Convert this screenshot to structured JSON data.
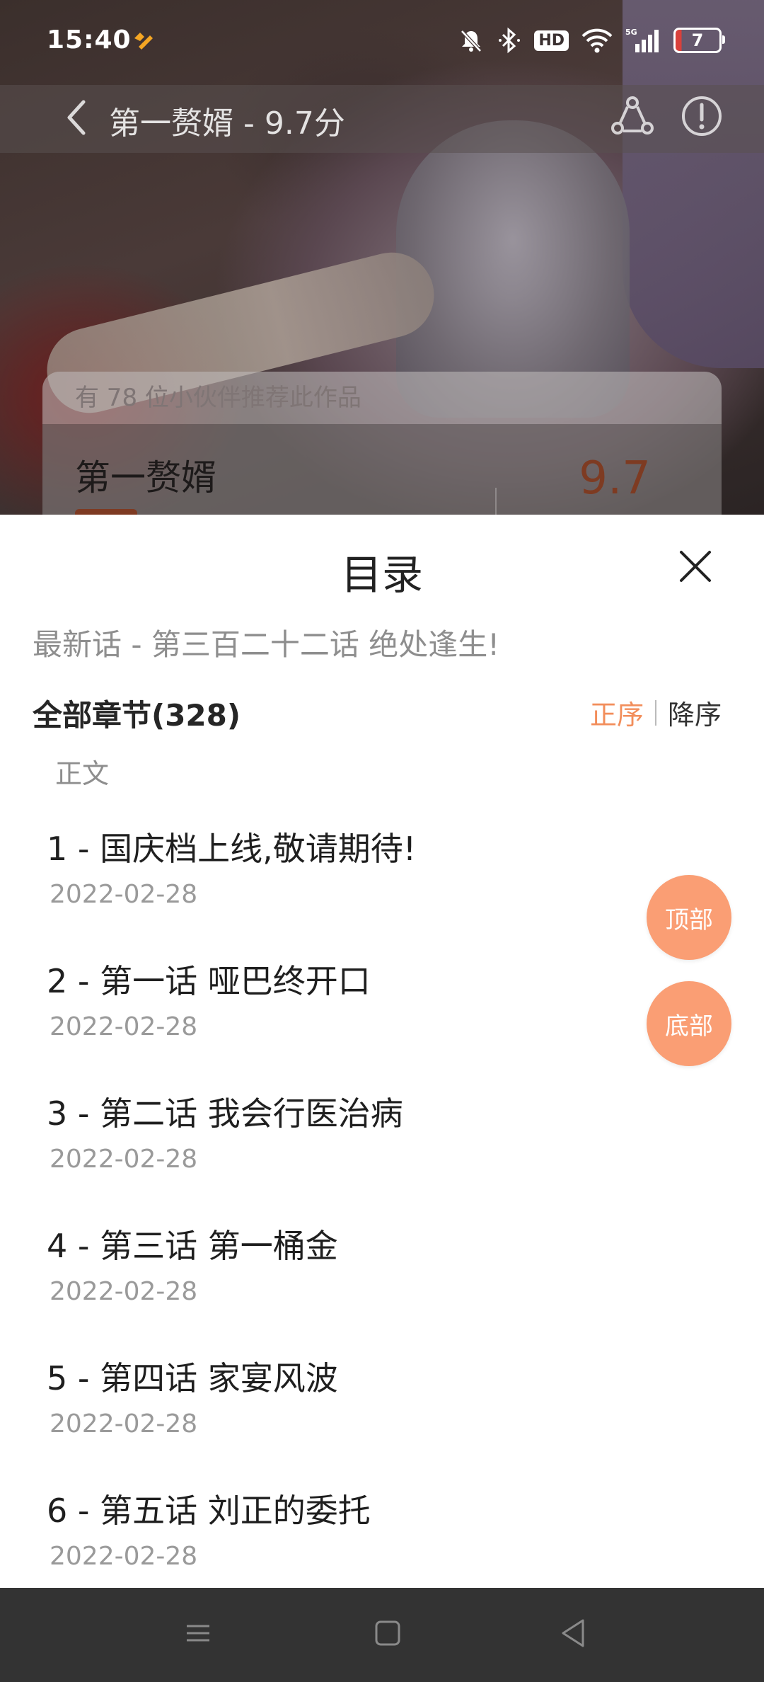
{
  "status_bar": {
    "time": "15:40",
    "hd_label": "HD",
    "network_label": "5G",
    "battery_level": "7"
  },
  "header": {
    "title": "第一赘婿 - 9.7分"
  },
  "info_card": {
    "recommend_text": "有 78 位小伙伴推荐此作品",
    "name": "第一赘婿",
    "score": "9.7"
  },
  "catalog": {
    "title": "目录",
    "latest": "最新话 - 第三百二十二话 绝处逢生!",
    "all_chapters_label": "全部章节(328)",
    "sort_asc_label": "正序",
    "sort_desc_label": "降序",
    "section_label": "正文",
    "chapters": [
      {
        "title": "1 - 国庆档上线,敬请期待!",
        "date": "2022-02-28"
      },
      {
        "title": "2 - 第一话 哑巴终开口",
        "date": "2022-02-28"
      },
      {
        "title": "3 - 第二话 我会行医治病",
        "date": "2022-02-28"
      },
      {
        "title": "4 - 第三话 第一桶金",
        "date": "2022-02-28"
      },
      {
        "title": "5 - 第四话 家宴风波",
        "date": "2022-02-28"
      },
      {
        "title": "6 - 第五话 刘正的委托",
        "date": "2022-02-28"
      }
    ],
    "fab_top_label": "顶部",
    "fab_bottom_label": "底部"
  },
  "colors": {
    "accent": "#f28e5b",
    "fab": "#fa9e74",
    "nav_bar": "#333333"
  },
  "icons": {
    "back": "chevron-left-icon",
    "share": "share-icon",
    "report": "exclamation-circle-icon",
    "close": "close-icon",
    "nav_menu": "menu-icon",
    "nav_home": "square-home-icon",
    "nav_back": "triangle-back-icon"
  }
}
